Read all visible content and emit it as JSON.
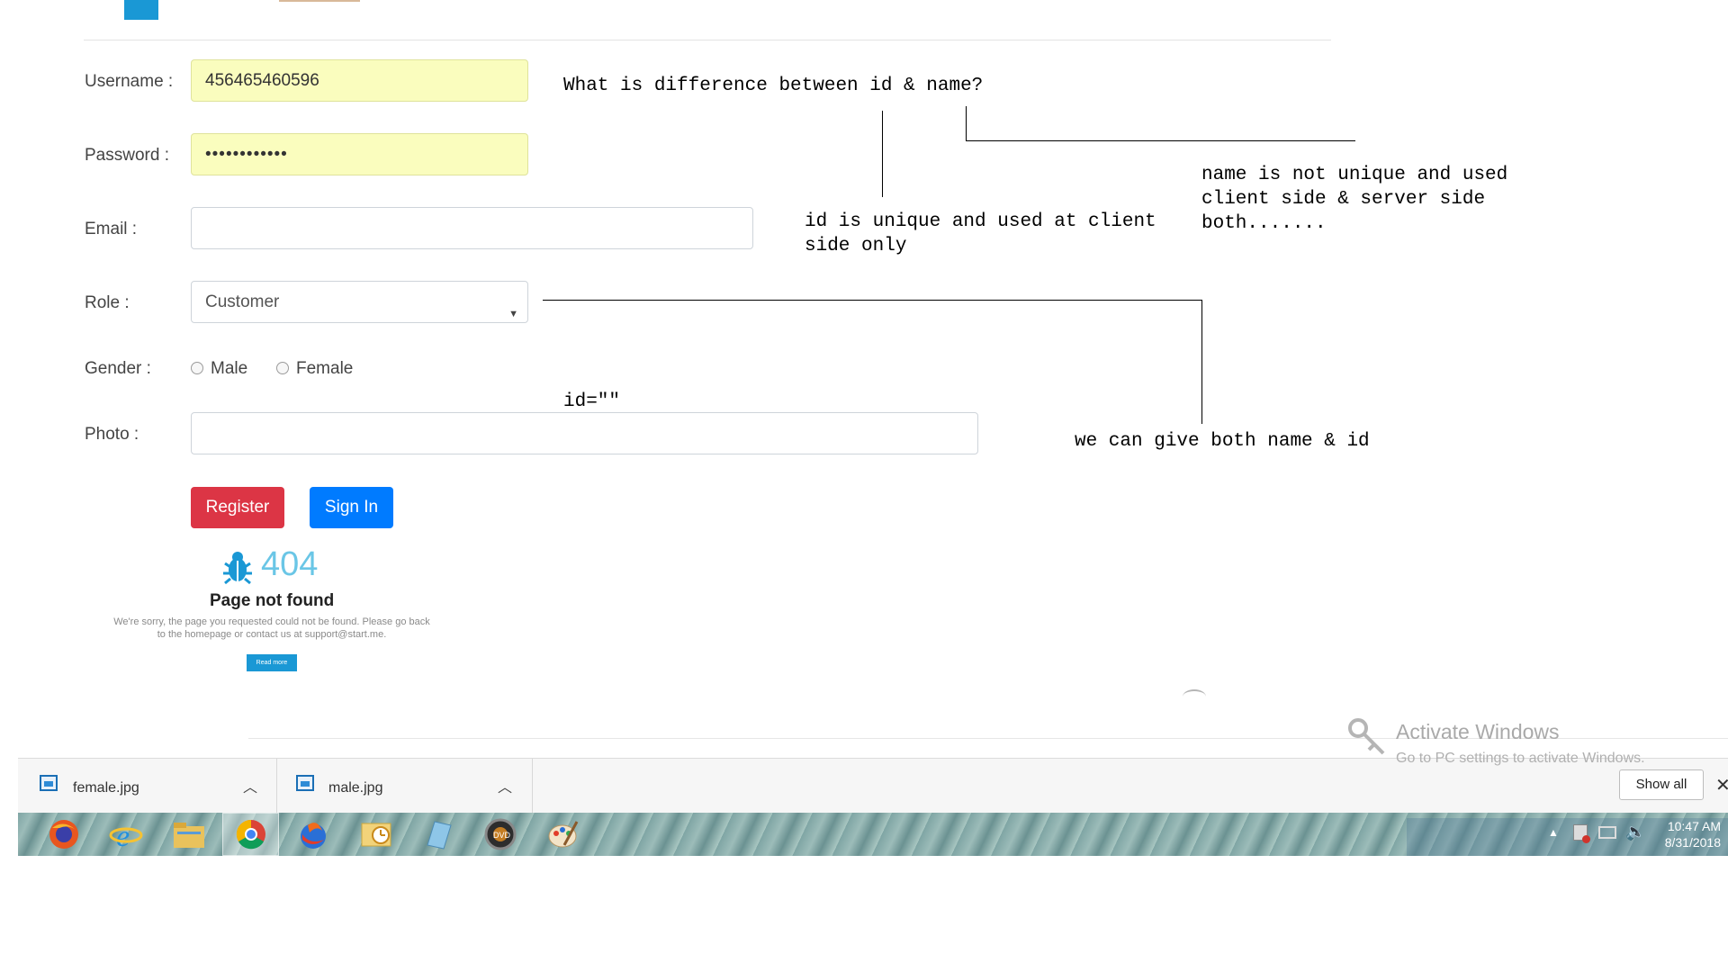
{
  "form": {
    "username_label": "Username :",
    "username_value": "456465460596",
    "password_label": "Password :",
    "password_value": "••••••••••••",
    "email_label": "Email :",
    "email_value": "",
    "role_label": "Role :",
    "role_value": "Customer",
    "gender_label": "Gender :",
    "gender_options": [
      "Male",
      "Female"
    ],
    "photo_label": "Photo :",
    "register_label": "Register",
    "signin_label": "Sign In"
  },
  "annotations": {
    "question": "What is difference between id & name?",
    "id_text": "id is unique and used at client\nside only",
    "name_text": "name is not unique and used\nclient side & server side\nboth.......",
    "both_text": "we can give both name & id",
    "id_attr": "id=\"\""
  },
  "not_found": {
    "code": "404",
    "title": "Page not found",
    "message_line1": "We're sorry, the page you requested could not be found. Please go back",
    "message_line2": "to the homepage or contact us at support@start.me.",
    "button": "Read more"
  },
  "downloads": {
    "items": [
      {
        "name": "female.jpg"
      },
      {
        "name": "male.jpg"
      }
    ],
    "show_all": "Show all"
  },
  "taskbar": {
    "apps": [
      "firefox-icon",
      "internet-explorer-icon",
      "file-explorer-icon",
      "chrome-icon",
      "browser-icon",
      "outlook-icon",
      "notes-icon",
      "media-player-icon",
      "paint-icon"
    ],
    "time": "10:47 AM",
    "date": "8/31/2018"
  },
  "watermark": {
    "title": "Activate Windows",
    "subtitle": "Go to PC settings to activate Windows."
  }
}
